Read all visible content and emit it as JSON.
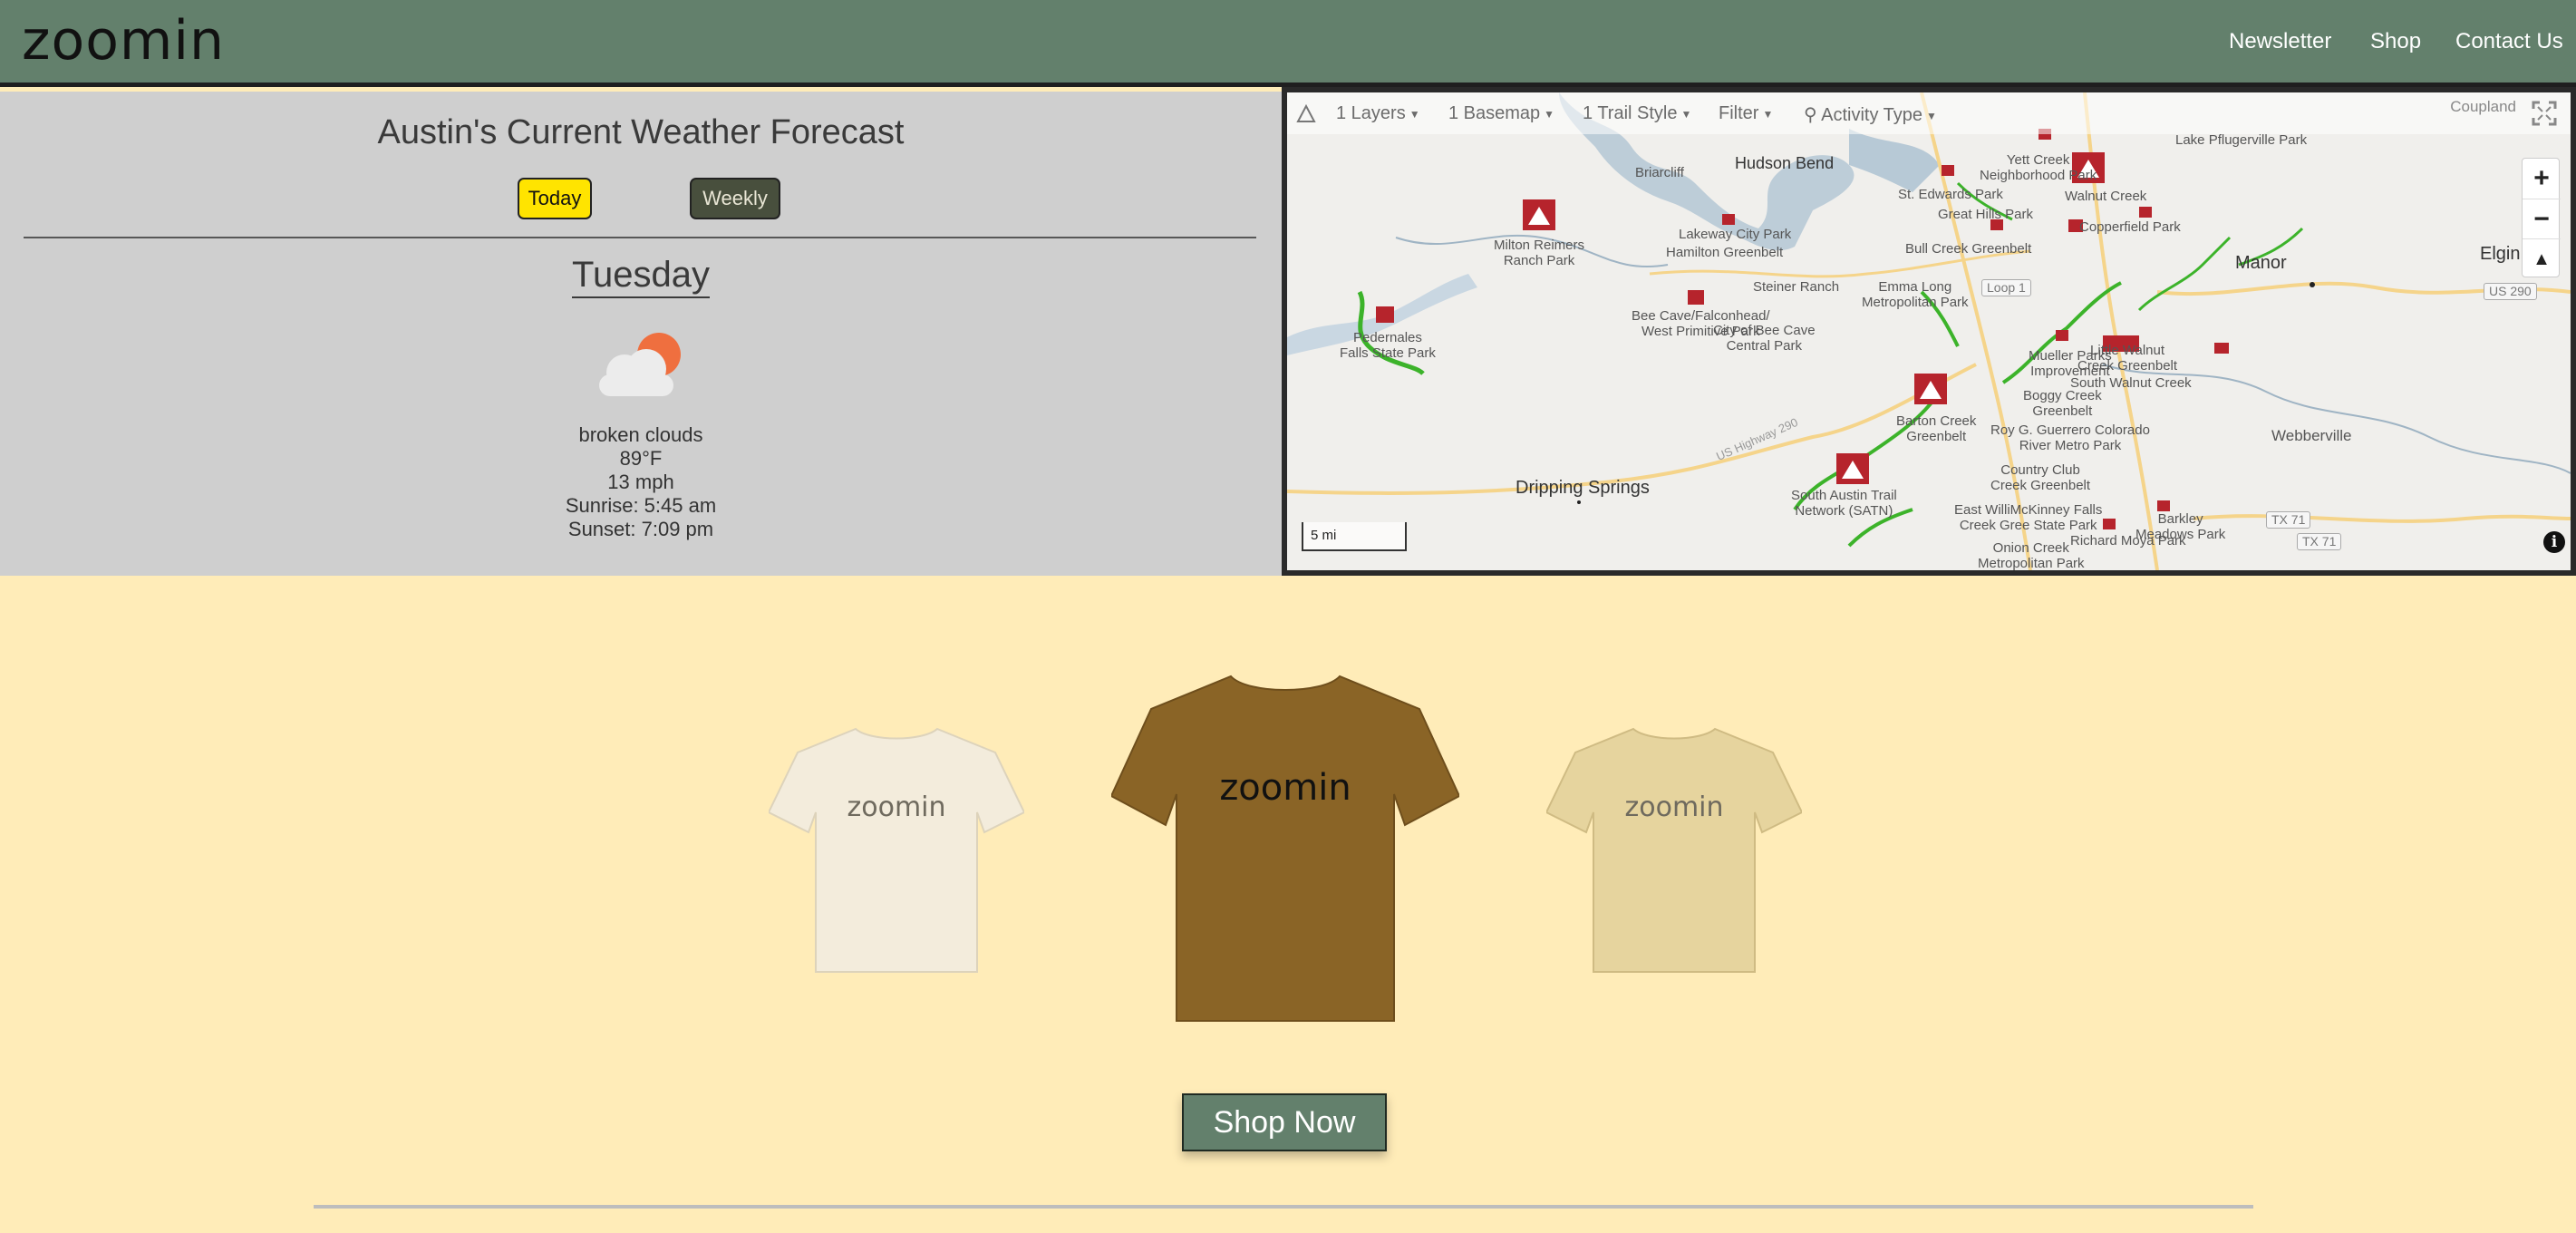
{
  "header": {
    "logo": "zoomin",
    "nav": [
      "Newsletter",
      "Shop",
      "Contact Us"
    ]
  },
  "weather": {
    "title": "Austin's Current Weather Forecast",
    "buttons": {
      "today": "Today",
      "weekly": "Weekly"
    },
    "day": "Tuesday",
    "icon": "partly-cloudy-icon",
    "condition": "broken clouds",
    "temperature": "89°F",
    "wind": "13 mph",
    "sunrise": "Sunrise: 5:45 am",
    "sunset": "Sunset: 7:09 pm"
  },
  "map": {
    "toolbar": [
      "1 Layers",
      "1 Basemap",
      "1 Trail Style",
      "Filter",
      "Activity Type"
    ],
    "corner_label": "Coupland",
    "scale": "5 mi",
    "labels": {
      "briarcliff": "Briarcliff",
      "hudson_bend": "Hudson Bend",
      "lakeway": "Lakeway City Park",
      "hamilton": "Hamilton Greenbelt",
      "milton": "Milton Reimers\nRanch Park",
      "pedernales": "Pedernales\nFalls State Park",
      "steiner": "Steiner Ranch",
      "emma": "Emma Long\nMetropolitan Park",
      "bee_cave": "Bee Cave/Falconhead/\nWest Primitive Park",
      "central": "City of Bee Cave\nCentral Park",
      "dripping": "Dripping Springs",
      "south_austin": "South Austin Trail\nNetwork (SATN)",
      "barton": "Barton Creek\nGreenbelt",
      "roy": "Roy G. Guerrero Colorado\nRiver Metro Park",
      "country_club": "Country Club\nCreek Greenbelt",
      "mckinney": "East WilliMcKinney Falls\nCreek Gree State Park",
      "onion": "Onion Creek\nMetropolitan Park",
      "richard": "Richard Moya Park",
      "barkley": "Barkley\nMeadows Park",
      "st_edwards": "St. Edwards Park",
      "yett": "Yett Creek\nNeighborhood Park",
      "walnut": "Walnut Creek",
      "great_hills": "Great Hills Park",
      "copperfield": "Copperfield Park",
      "bull_creek": "Bull Creek Greenbelt",
      "mueller": "Mueller Parks\nImprovement",
      "little_walnut": "Little Walnut\nCreek Greenbelt",
      "south_walnut": "South Walnut Creek",
      "boggy": "Boggy Creek\nGreenbelt",
      "manor": "Manor",
      "elgin": "Elgin",
      "webberville": "Webberville",
      "pflugerville": "Lake Pflugerville Park",
      "loop1": "Loop 1",
      "us290": "US 290",
      "tx71a": "TX 71",
      "tx71b": "TX 71",
      "hwy290": "US Highway 290"
    }
  },
  "shop": {
    "shirts": [
      {
        "text": "zoomin",
        "color": "#f3ecdc"
      },
      {
        "text": "zoomin",
        "color": "#8a6426"
      },
      {
        "text": "zoomin",
        "color": "#e6d49e"
      }
    ],
    "button": "Shop Now"
  }
}
